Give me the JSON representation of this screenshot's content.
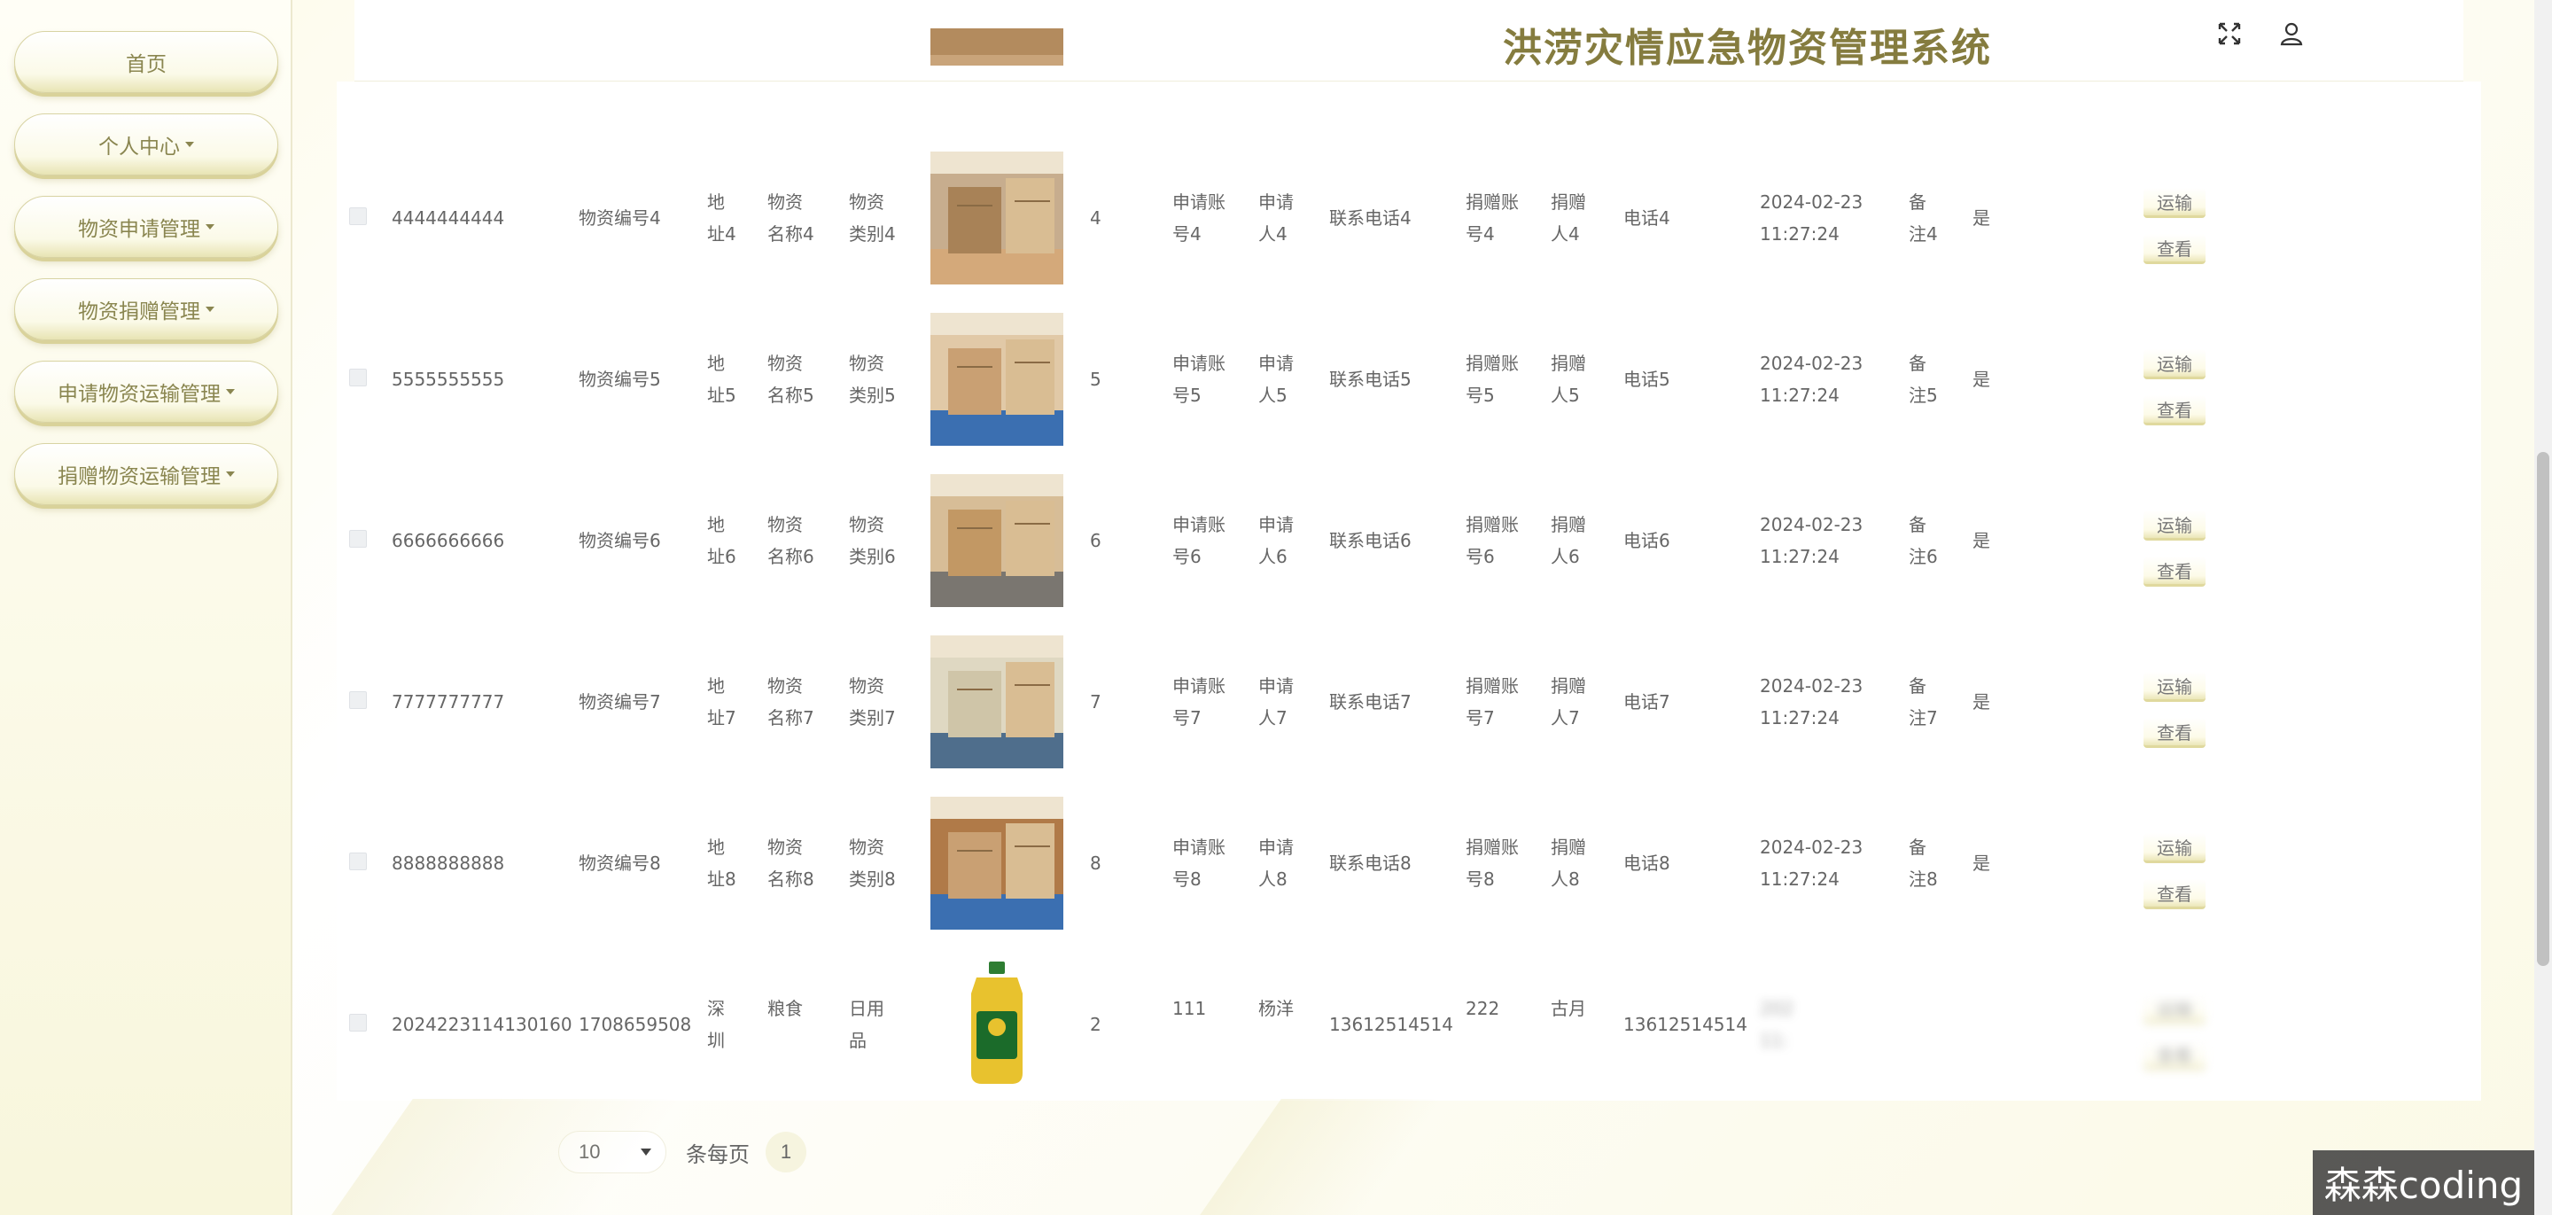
{
  "app": {
    "title": "洪涝灾情应急物资管理系统"
  },
  "sidebar": {
    "items": [
      {
        "label": "首页",
        "has_caret": false
      },
      {
        "label": "个人中心",
        "has_caret": true
      },
      {
        "label": "物资申请管理",
        "has_caret": true
      },
      {
        "label": "物资捐赠管理",
        "has_caret": true
      },
      {
        "label": "申请物资运输管理",
        "has_caret": true
      },
      {
        "label": "捐赠物资运输管理",
        "has_caret": true
      }
    ]
  },
  "header": {
    "fullscreen_icon": "fullscreen-icon",
    "user_icon": "user-icon"
  },
  "table": {
    "actions": {
      "transport": "运输",
      "view": "查看"
    },
    "rows": [
      {
        "id": "4444444444",
        "code": "物资编号4",
        "addr": [
          "地",
          "址4"
        ],
        "name": [
          "物资",
          "名称4"
        ],
        "cat": [
          "物资",
          "类别4"
        ],
        "qty": "4",
        "apply_acct": [
          "申请账",
          "号4"
        ],
        "applicant": [
          "申请",
          "人4"
        ],
        "phone": "联系电话4",
        "donor_acct": [
          "捐赠账",
          "号4"
        ],
        "donor": [
          "捐赠",
          "人4"
        ],
        "donor_phone": "电话4",
        "date": [
          "2024-02-23",
          "11:27:24"
        ],
        "note": [
          "备",
          "注4"
        ],
        "flag": "是"
      },
      {
        "id": "5555555555",
        "code": "物资编号5",
        "addr": [
          "地",
          "址5"
        ],
        "name": [
          "物资",
          "名称5"
        ],
        "cat": [
          "物资",
          "类别5"
        ],
        "qty": "5",
        "apply_acct": [
          "申请账",
          "号5"
        ],
        "applicant": [
          "申请",
          "人5"
        ],
        "phone": "联系电话5",
        "donor_acct": [
          "捐赠账",
          "号5"
        ],
        "donor": [
          "捐赠",
          "人5"
        ],
        "donor_phone": "电话5",
        "date": [
          "2024-02-23",
          "11:27:24"
        ],
        "note": [
          "备",
          "注5"
        ],
        "flag": "是"
      },
      {
        "id": "6666666666",
        "code": "物资编号6",
        "addr": [
          "地",
          "址6"
        ],
        "name": [
          "物资",
          "名称6"
        ],
        "cat": [
          "物资",
          "类别6"
        ],
        "qty": "6",
        "apply_acct": [
          "申请账",
          "号6"
        ],
        "applicant": [
          "申请",
          "人6"
        ],
        "phone": "联系电话6",
        "donor_acct": [
          "捐赠账",
          "号6"
        ],
        "donor": [
          "捐赠",
          "人6"
        ],
        "donor_phone": "电话6",
        "date": [
          "2024-02-23",
          "11:27:24"
        ],
        "note": [
          "备",
          "注6"
        ],
        "flag": "是"
      },
      {
        "id": "7777777777",
        "code": "物资编号7",
        "addr": [
          "地",
          "址7"
        ],
        "name": [
          "物资",
          "名称7"
        ],
        "cat": [
          "物资",
          "类别7"
        ],
        "qty": "7",
        "apply_acct": [
          "申请账",
          "号7"
        ],
        "applicant": [
          "申请",
          "人7"
        ],
        "phone": "联系电话7",
        "donor_acct": [
          "捐赠账",
          "号7"
        ],
        "donor": [
          "捐赠",
          "人7"
        ],
        "donor_phone": "电话7",
        "date": [
          "2024-02-23",
          "11:27:24"
        ],
        "note": [
          "备",
          "注7"
        ],
        "flag": "是"
      },
      {
        "id": "8888888888",
        "code": "物资编号8",
        "addr": [
          "地",
          "址8"
        ],
        "name": [
          "物资",
          "名称8"
        ],
        "cat": [
          "物资",
          "类别8"
        ],
        "qty": "8",
        "apply_acct": [
          "申请账",
          "号8"
        ],
        "applicant": [
          "申请",
          "人8"
        ],
        "phone": "联系电话8",
        "donor_acct": [
          "捐赠账",
          "号8"
        ],
        "donor": [
          "捐赠",
          "人8"
        ],
        "donor_phone": "电话8",
        "date": [
          "2024-02-23",
          "11:27:24"
        ],
        "note": [
          "备",
          "注8"
        ],
        "flag": "是"
      },
      {
        "id": "2024223114130160",
        "code": "1708659508",
        "addr": [
          "深",
          "圳"
        ],
        "name": [
          "粮食",
          ""
        ],
        "cat": [
          "日用",
          "品"
        ],
        "qty": "2",
        "apply_acct": [
          "111",
          ""
        ],
        "applicant": [
          "杨洋",
          ""
        ],
        "phone": "13612514514",
        "donor_acct": [
          "222",
          ""
        ],
        "donor": [
          "古月",
          ""
        ],
        "donor_phone": "13612514514",
        "date": [
          "202",
          "11:"
        ],
        "note": [
          "",
          ""
        ],
        "flag": ""
      }
    ]
  },
  "pager": {
    "page_size": "10",
    "per_page_label": "条每页",
    "current_page": "1"
  },
  "watermark": "森森coding"
}
